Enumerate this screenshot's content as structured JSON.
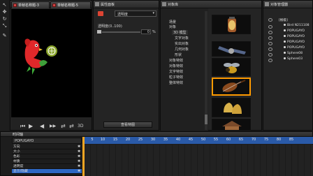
{
  "preview": {
    "tabs": [
      {
        "label": "单帧名称题-3"
      },
      {
        "label": "单帧名称题-5"
      }
    ],
    "play_controls": [
      "⏮",
      "▶",
      "◀",
      "▶▶",
      "⇄",
      "⇄",
      "3D"
    ]
  },
  "properties": {
    "title": "属性面板",
    "dropdown_value": "透明度",
    "field_label": "透明度(0..100)",
    "field_value": "0",
    "unit": "%",
    "button_label": "查看特图"
  },
  "library": {
    "title": "对象库",
    "tree": [
      "场景",
      "对象",
      "3D 模型",
      "文字对象",
      "实出对象",
      "几何对象",
      "形状",
      "对象特效",
      "对象特效",
      "文字特效",
      "粒子特效",
      "整体特效"
    ]
  },
  "object_manager": {
    "title": "对象管理器",
    "root": "[根级]",
    "items": [
      "Bird N211108",
      "POPUGAYO",
      "POPUGAYO",
      "POPUGAYO",
      "POPUGAYO",
      "Sphere08",
      "Sphere03"
    ]
  },
  "timeline": {
    "title": "时间轴",
    "selected_object": "POPUGAYO",
    "tracks": [
      "方向",
      "大小",
      "色彩",
      "材质",
      "透明度",
      "显示/隐藏"
    ],
    "ruler": [
      "5",
      "10",
      "15",
      "20",
      "25",
      "30",
      "35",
      "40",
      "45",
      "50",
      "55",
      "60",
      "65",
      "70",
      "75",
      "80",
      "85"
    ],
    "current_frame": "0"
  },
  "colors": {
    "ruler_blue": "#2a5aa8",
    "selected_track": "#2e68c4",
    "keyframe": "#f5a623",
    "thumb_highlight": "#ff9a00"
  }
}
